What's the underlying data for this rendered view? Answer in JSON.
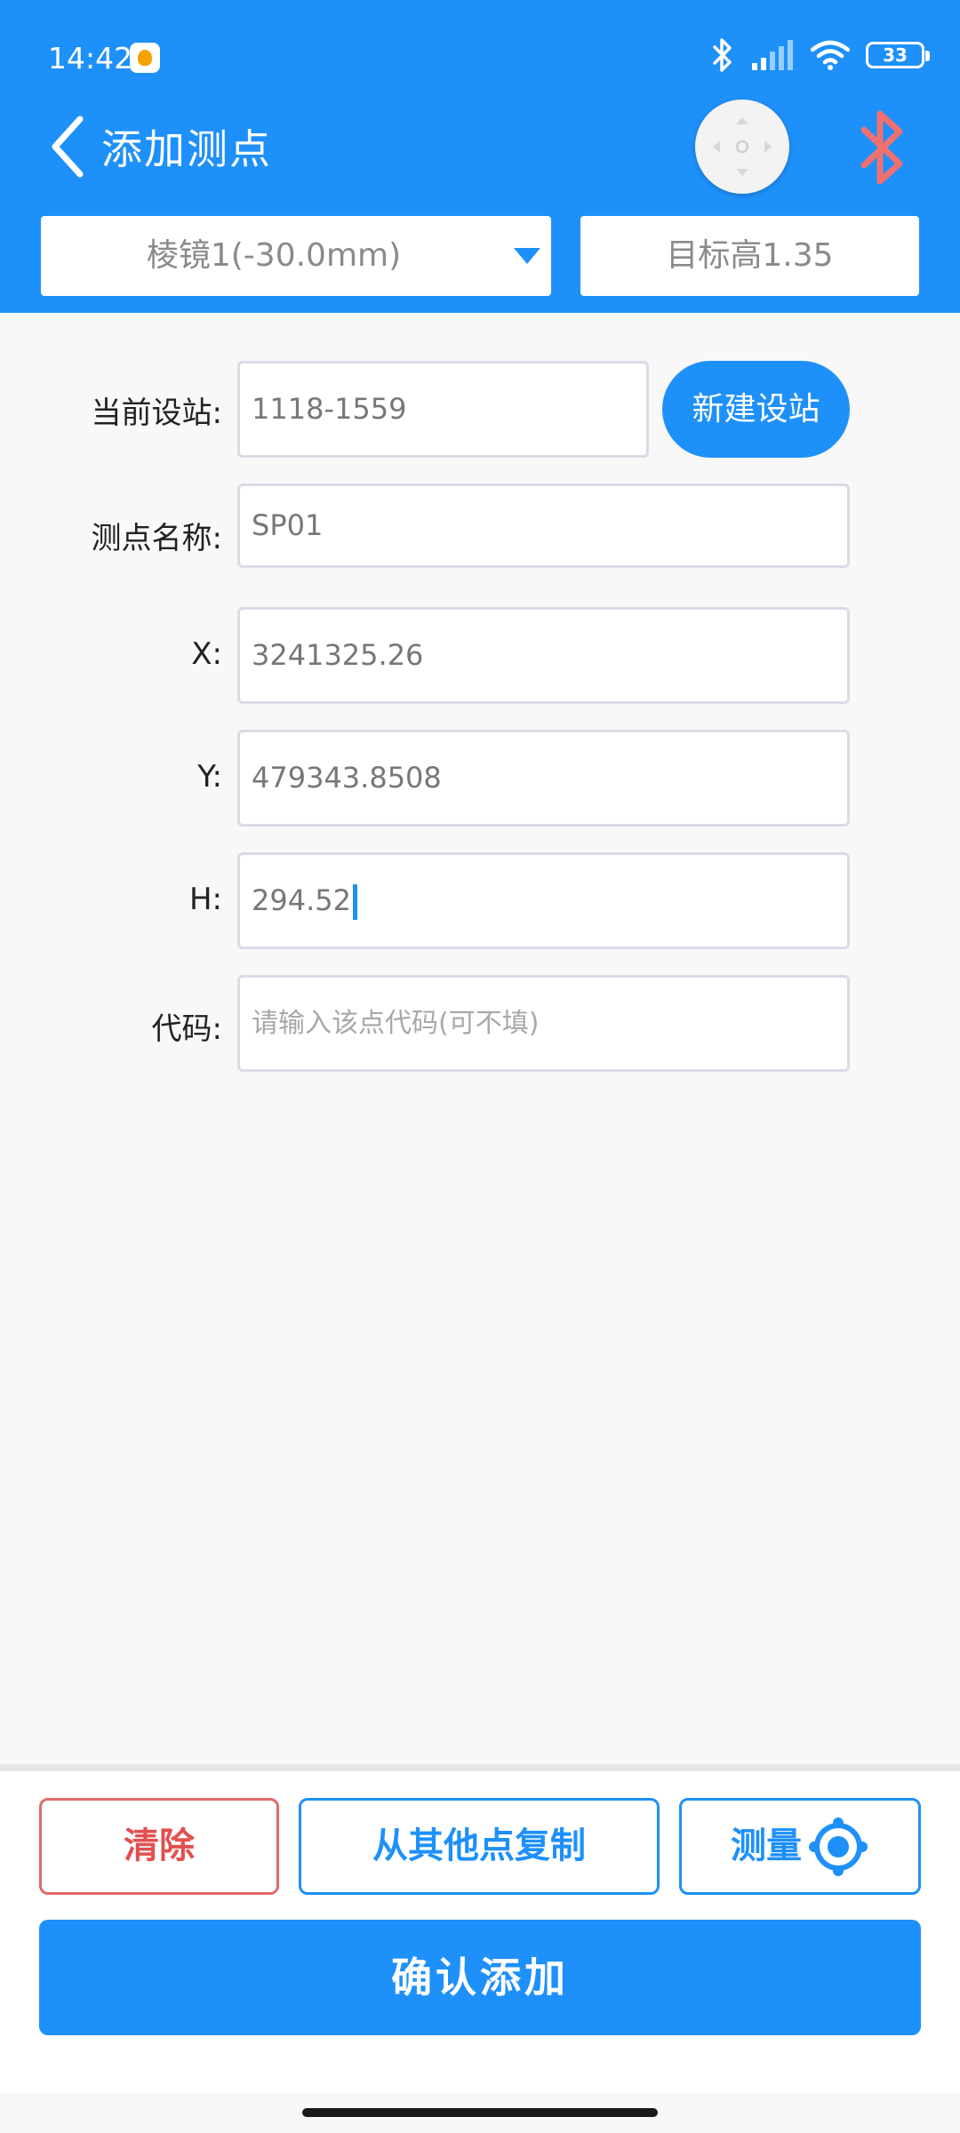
{
  "status_bar": {
    "time": "14:42",
    "battery": "33",
    "icons": [
      "bluetooth-icon",
      "signal-icon",
      "wifi-icon",
      "battery-icon"
    ]
  },
  "header": {
    "title": "添加测点",
    "prism_select": "棱镜1(-30.0mm)",
    "target_height": "目标高1.35"
  },
  "form": {
    "station": {
      "label": "当前设站:",
      "value": "1118-1559",
      "button": "新建设站"
    },
    "point_name": {
      "label": "测点名称:",
      "value": "SP01"
    },
    "x": {
      "label": "X:",
      "value": "3241325.26"
    },
    "y": {
      "label": "Y:",
      "value": "479343.8508"
    },
    "h": {
      "label": "H:",
      "value": "294.52"
    },
    "code": {
      "label": "代码:",
      "placeholder": "请输入该点代码(可不填)"
    }
  },
  "footer": {
    "clear": "清除",
    "copy": "从其他点复制",
    "measure": "测量",
    "confirm": "确认添加"
  },
  "colors": {
    "primary": "#1e90fa",
    "danger": "#e34f4f",
    "bluetooth_disconnected": "#f07070"
  }
}
